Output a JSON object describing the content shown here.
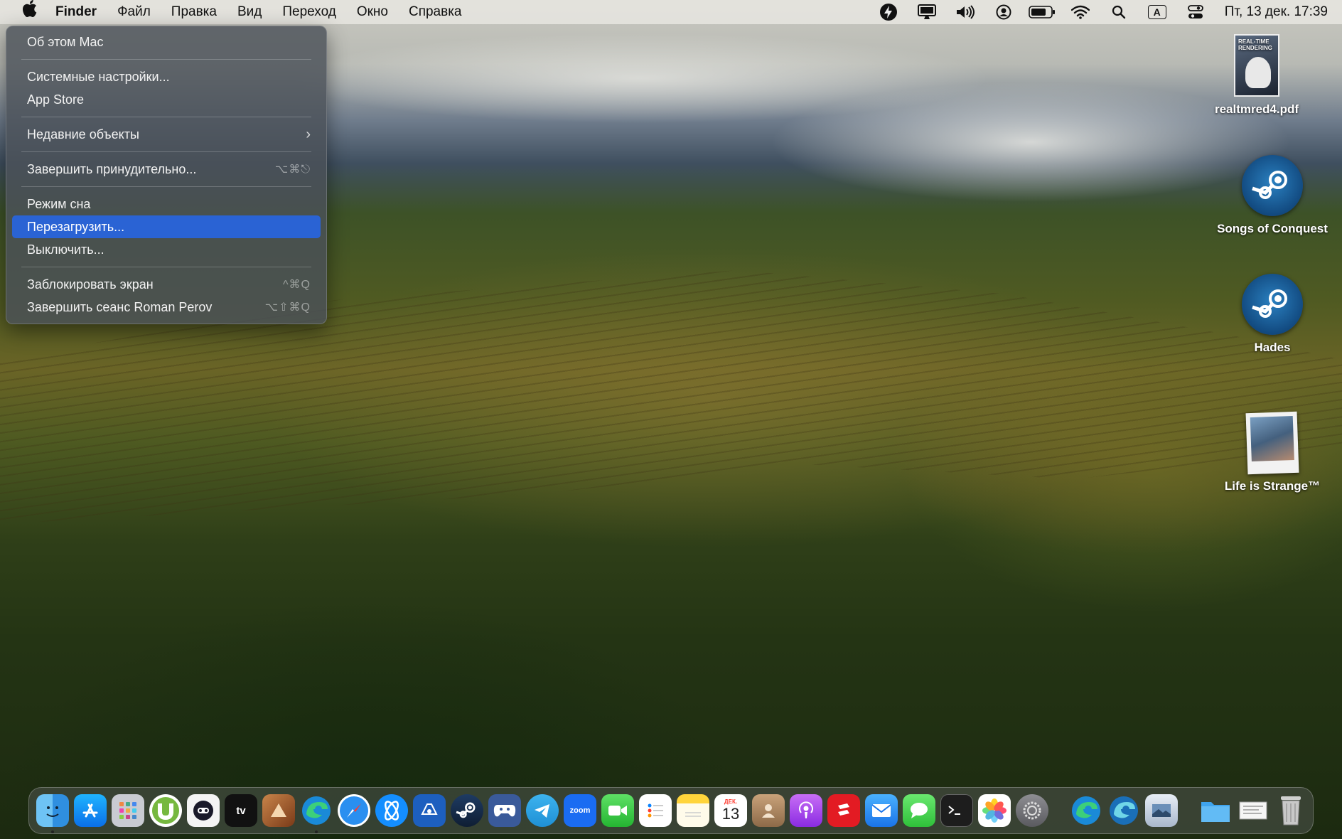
{
  "menubar": {
    "apple": "",
    "app_name": "Finder",
    "items": [
      "Файл",
      "Правка",
      "Вид",
      "Переход",
      "Окно",
      "Справка"
    ],
    "status_icons": [
      "bolt-icon",
      "display-icon",
      "volume-icon",
      "user-icon",
      "battery-icon",
      "wifi-icon",
      "search-icon",
      "input-source-icon",
      "control-center-icon"
    ],
    "input_source": "A",
    "clock": "Пт, 13 дек.  17:39"
  },
  "apple_menu": {
    "about": "Об этом Mac",
    "settings": "Системные настройки...",
    "app_store": "App Store",
    "recent": "Недавние объекты",
    "force_quit": "Завершить принудительно...",
    "force_quit_shortcut": "⌥⌘⎋",
    "sleep": "Режим сна",
    "restart": "Перезагрузить...",
    "shutdown": "Выключить...",
    "lock": "Заблокировать экран",
    "lock_shortcut": "^⌘Q",
    "logout": "Завершить сеанс Roman Perov",
    "logout_shortcut": "⌥⇧⌘Q"
  },
  "desktop": {
    "pdf_label": "realtmred4.pdf",
    "pdf_cover_text": "REAL-TIME RENDERING",
    "songs_label": "Songs of Conquest",
    "hades_label": "Hades",
    "lis_label": "Life is Strange™"
  },
  "dock": {
    "calendar_month": "ДЕК.",
    "calendar_day": "13",
    "tv_label": "tv",
    "zoom_label": "zoom",
    "apps": [
      "finder-icon",
      "app-store-icon",
      "launchpad-icon",
      "utorrent-icon",
      "robot-app-icon",
      "apple-tv-icon",
      "affinity-icon",
      "edge-icon",
      "safari-icon",
      "battle-net-icon",
      "game-controller-app-icon",
      "steam-icon",
      "controller-icon",
      "telegram-icon",
      "zoom-icon",
      "facetime-icon",
      "reminders-icon",
      "notes-icon",
      "calendar-icon",
      "contacts-icon",
      "podcasts-icon",
      "red-app-icon",
      "mail-icon",
      "messages-icon",
      "terminal-icon",
      "photos-icon",
      "system-settings-icon",
      "edge-icon",
      "edge-beta-icon",
      "preview-icon",
      "folder-icon",
      "document-icon",
      "trash-icon"
    ]
  }
}
